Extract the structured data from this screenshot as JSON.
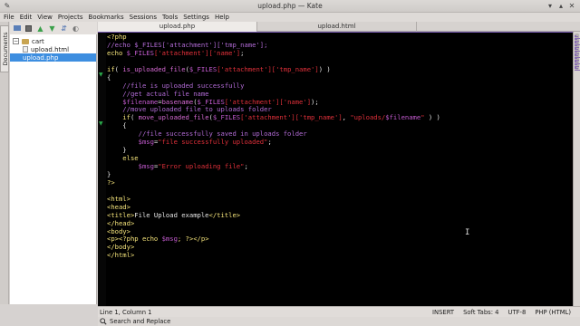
{
  "window": {
    "title": "upload.php  —  Kate"
  },
  "menu": [
    "File",
    "Edit",
    "View",
    "Projects",
    "Bookmarks",
    "Sessions",
    "Tools",
    "Settings",
    "Help"
  ],
  "side_panel": {
    "tab_label": "Documents",
    "items": [
      {
        "label": "cart",
        "type": "folder"
      },
      {
        "label": "upload.html",
        "type": "file"
      },
      {
        "label": "upload.php",
        "type": "file",
        "selected": true
      }
    ]
  },
  "tabs": [
    {
      "label": "upload.php",
      "active": true
    },
    {
      "label": "upload.html",
      "active": false
    },
    {
      "label": "",
      "active": false
    }
  ],
  "code_lines": [
    [
      [
        "k",
        "<?php"
      ]
    ],
    [
      [
        "c",
        "//echo $_FILES['attachment']['tmp_name'];"
      ]
    ],
    [
      [
        "k",
        "echo "
      ],
      [
        "v",
        "$_FILES"
      ],
      [
        "s",
        "['attachment']['name']"
      ],
      [
        "w",
        ";"
      ]
    ],
    [
      [
        "w",
        ""
      ]
    ],
    [
      [
        "k",
        "if"
      ],
      [
        "w",
        "( "
      ],
      [
        "f",
        "is_uploaded_file"
      ],
      [
        "w",
        "("
      ],
      [
        "v",
        "$_FILES"
      ],
      [
        "s",
        "['attachment']['tmp_name']"
      ],
      [
        "w",
        ") )"
      ]
    ],
    [
      [
        "w",
        "{"
      ]
    ],
    [
      [
        "c",
        "    //file is uploaded successfully"
      ]
    ],
    [
      [
        "c",
        "    //get actual file name"
      ]
    ],
    [
      [
        "v",
        "    $filename"
      ],
      [
        "w",
        "="
      ],
      [
        "f",
        "basename"
      ],
      [
        "w",
        "("
      ],
      [
        "v",
        "$_FILES"
      ],
      [
        "s",
        "['attachment']['name']"
      ],
      [
        "w",
        ");"
      ]
    ],
    [
      [
        "c",
        "    //move uploaded file to uploads folder"
      ]
    ],
    [
      [
        "k",
        "    if"
      ],
      [
        "w",
        "( "
      ],
      [
        "f",
        "move_uploaded_file"
      ],
      [
        "w",
        "("
      ],
      [
        "v",
        "$_FILES"
      ],
      [
        "s",
        "['attachment']['tmp_name']"
      ],
      [
        "w",
        ", "
      ],
      [
        "s",
        "\"uploads/"
      ],
      [
        "v",
        "$filename"
      ],
      [
        "s",
        "\""
      ],
      [
        "w",
        " ) )"
      ]
    ],
    [
      [
        "w",
        "    {"
      ]
    ],
    [
      [
        "c",
        "        //file successfully saved in uploads folder"
      ]
    ],
    [
      [
        "v",
        "        $msg"
      ],
      [
        "w",
        "="
      ],
      [
        "s",
        "\"file successfully uploaded\""
      ],
      [
        "w",
        ";"
      ]
    ],
    [
      [
        "w",
        "    }"
      ]
    ],
    [
      [
        "k",
        "    else"
      ]
    ],
    [
      [
        "v",
        "        $msg"
      ],
      [
        "w",
        "="
      ],
      [
        "s",
        "\"Error uploading file\""
      ],
      [
        "w",
        ";"
      ]
    ],
    [
      [
        "w",
        "}"
      ]
    ],
    [
      [
        "k",
        "?>"
      ]
    ],
    [
      [
        "w",
        ""
      ]
    ],
    [
      [
        "k",
        "<html>"
      ]
    ],
    [
      [
        "k",
        "<head>"
      ]
    ],
    [
      [
        "k",
        "<title>"
      ],
      [
        "w",
        "File Upload example"
      ],
      [
        "k",
        "</title>"
      ]
    ],
    [
      [
        "k",
        "</head>"
      ]
    ],
    [
      [
        "k",
        "<body>"
      ]
    ],
    [
      [
        "k",
        "<p><?php echo "
      ],
      [
        "v",
        "$msg"
      ],
      [
        "k",
        "; ?></p>"
      ]
    ],
    [
      [
        "k",
        "</body>"
      ]
    ],
    [
      [
        "k",
        "</html>"
      ]
    ]
  ],
  "status": {
    "position": "Line 1, Column 1",
    "mode": "INSERT",
    "tabs": "Soft Tabs: 4",
    "encoding": "UTF-8",
    "syntax": "PHP (HTML)"
  },
  "bottom": {
    "search_label": "Search and Replace"
  },
  "colors": {
    "keyword": "#f4e37a",
    "variable": "#c45bd0",
    "string": "#e0303a",
    "comment": "#b26bd6",
    "selection": "#3d8ee0"
  }
}
